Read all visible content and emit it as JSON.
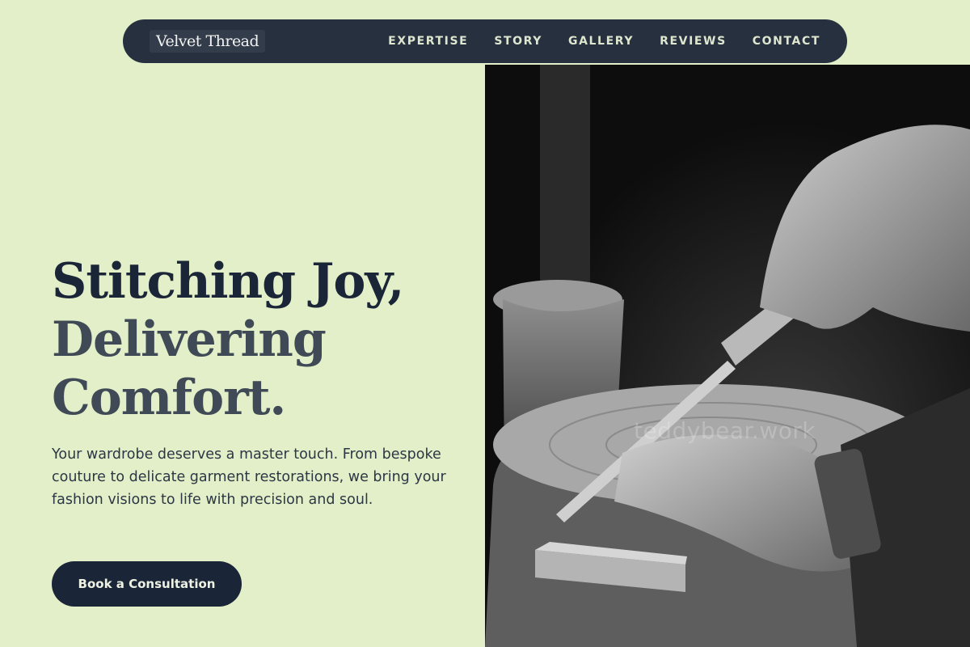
{
  "nav": {
    "brand": "Velvet Thread",
    "links": [
      "EXPERTISE",
      "STORY",
      "GALLERY",
      "REVIEWS",
      "CONTACT"
    ]
  },
  "hero": {
    "headline": [
      "Stitching Joy,",
      "Delivering",
      "Comfort."
    ],
    "subtext": "Your wardrobe deserves a master touch. From bespoke couture to delicate garment restorations, we bring your fashion visions to life with precision and soul.",
    "cta_label": "Book a Consultation",
    "image_watermark": "teddybear.work"
  },
  "colors": {
    "background": "#e3efc9",
    "nav_background": "#27303e",
    "headline_dark": "#1b2538",
    "headline_muted": "#3f4a56",
    "button": "#1b2538"
  }
}
